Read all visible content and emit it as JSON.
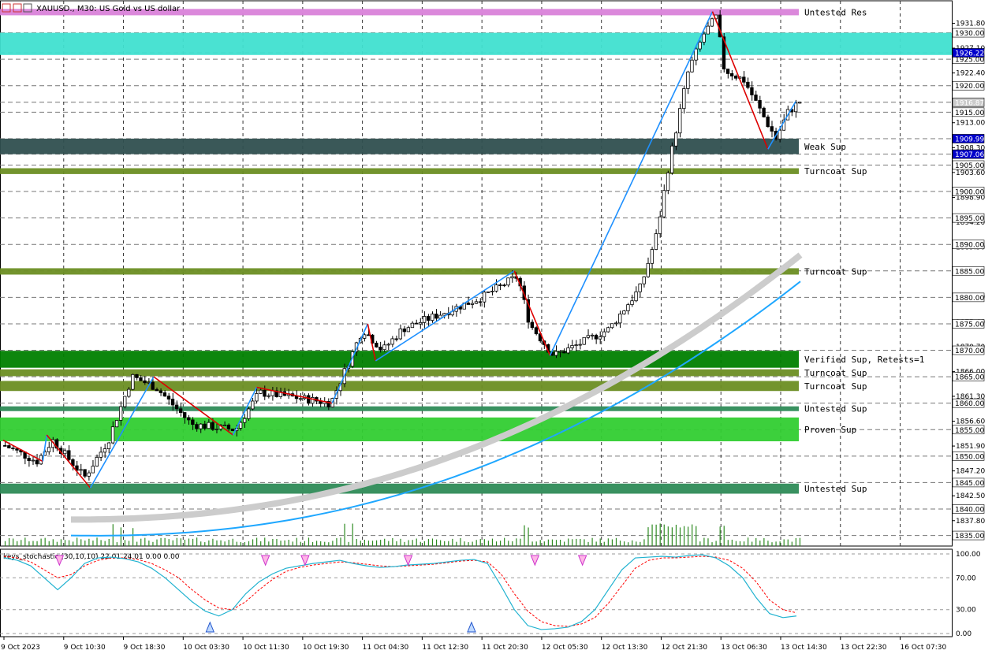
{
  "chart_data": {
    "type": "candlestick",
    "title": "XAUUSD., M30: US Gold vs US dollar",
    "ylim": [
      1833.0,
      1935.0
    ],
    "price_ticks": [
      "1931.80",
      "1927.10",
      "1922.40",
      "1913.00",
      "1908.30",
      "1903.60",
      "1898.90",
      "1894.20",
      "1889.50",
      "1880.10",
      "1875.40",
      "1870.70",
      "1866.00",
      "1861.30",
      "1856.60",
      "1851.90",
      "1847.20",
      "1842.50",
      "1837.80"
    ],
    "price_boxes": [
      {
        "value": 1930.0,
        "label": "1930.00",
        "bg": "#ffffff",
        "fg": "#000000"
      },
      {
        "value": 1925.0,
        "label": "1925.00",
        "bg": "#ffffff",
        "fg": "#000000"
      },
      {
        "value": 1926.22,
        "label": "1926.22",
        "bg": "#0000cc",
        "fg": "#ffffff"
      },
      {
        "value": 1920.0,
        "label": "1920.00",
        "bg": "#ffffff",
        "fg": "#000000"
      },
      {
        "value": 1916.87,
        "label": "1916.87",
        "bg": "#cccccc",
        "fg": "#ffffff"
      },
      {
        "value": 1915.0,
        "label": "1915.00",
        "bg": "#ffffff",
        "fg": "#000000"
      },
      {
        "value": 1909.99,
        "label": "1909.99",
        "bg": "#0000cc",
        "fg": "#ffffff"
      },
      {
        "value": 1907.06,
        "label": "1907.06",
        "bg": "#0000cc",
        "fg": "#ffffff"
      },
      {
        "value": 1905.0,
        "label": "1905.00",
        "bg": "#ffffff",
        "fg": "#000000"
      },
      {
        "value": 1900.0,
        "label": "1900.00",
        "bg": "#ffffff",
        "fg": "#000000"
      },
      {
        "value": 1895.0,
        "label": "1895.00",
        "bg": "#ffffff",
        "fg": "#000000"
      },
      {
        "value": 1890.0,
        "label": "1890.00",
        "bg": "#ffffff",
        "fg": "#000000"
      },
      {
        "value": 1885.0,
        "label": "1885.00",
        "bg": "#ffffff",
        "fg": "#000000"
      },
      {
        "value": 1880.0,
        "label": "1880.00",
        "bg": "#ffffff",
        "fg": "#000000"
      },
      {
        "value": 1875.0,
        "label": "1875.00",
        "bg": "#ffffff",
        "fg": "#000000"
      },
      {
        "value": 1870.0,
        "label": "1870.00",
        "bg": "#ffffff",
        "fg": "#000000"
      },
      {
        "value": 1865.0,
        "label": "1865.00",
        "bg": "#ffffff",
        "fg": "#000000"
      },
      {
        "value": 1860.0,
        "label": "1860.00",
        "bg": "#ffffff",
        "fg": "#000000"
      },
      {
        "value": 1855.0,
        "label": "1855.00",
        "bg": "#ffffff",
        "fg": "#000000"
      },
      {
        "value": 1850.0,
        "label": "1850.00",
        "bg": "#ffffff",
        "fg": "#000000"
      },
      {
        "value": 1845.0,
        "label": "1845.00",
        "bg": "#ffffff",
        "fg": "#000000"
      },
      {
        "value": 1840.0,
        "label": "1840.00",
        "bg": "#ffffff",
        "fg": "#000000"
      },
      {
        "value": 1835.0,
        "label": "1835.00",
        "bg": "#ffffff",
        "fg": "#000000"
      }
    ],
    "x_labels": [
      "9 Oct 2023",
      "9 Oct 10:30",
      "9 Oct 18:30",
      "10 Oct 03:30",
      "10 Oct 11:30",
      "10 Oct 19:30",
      "11 Oct 04:30",
      "11 Oct 12:30",
      "11 Oct 20:30",
      "12 Oct 05:30",
      "12 Oct 13:30",
      "12 Oct 21:30",
      "13 Oct 06:30",
      "13 Oct 14:30",
      "13 Oct 22:30",
      "16 Oct 07:30"
    ],
    "zones": [
      {
        "label": "Untested Res",
        "top": 1934.5,
        "bottom": 1933.3,
        "color": "#d982d9",
        "x_end": 0.66
      },
      {
        "label": "",
        "top": 1930.0,
        "bottom": 1925.8,
        "color": "#40e0d0",
        "x_end": 1.0
      },
      {
        "label": "Weak Sup",
        "top": 1909.99,
        "bottom": 1907.06,
        "color": "#2f4f4f",
        "x_end": 0.66
      },
      {
        "label": "Turncoat Sup",
        "top": 1904.4,
        "bottom": 1903.3,
        "color": "#6b8e23",
        "x_end": 0.66
      },
      {
        "label": "Turncoat Sup",
        "top": 1885.5,
        "bottom": 1884.3,
        "color": "#6b8e23",
        "x_end": 0.66
      },
      {
        "label": "Verified Sup, Retests=1",
        "top": 1869.9,
        "bottom": 1866.7,
        "color": "#008000",
        "x_end": 0.66
      },
      {
        "label": "Turncoat Sup",
        "top": 1866.4,
        "bottom": 1865.1,
        "color": "#6b8e23",
        "x_end": 0.66
      },
      {
        "label": "Turncoat Sup",
        "top": 1864.2,
        "bottom": 1862.3,
        "color": "#6b8e23",
        "x_end": 0.66
      },
      {
        "label": "Untested Sup",
        "top": 1859.4,
        "bottom": 1858.5,
        "color": "#2e8b57",
        "x_end": 0.66
      },
      {
        "label": "Proven Sup",
        "top": 1857.3,
        "bottom": 1852.8,
        "color": "#32cd32",
        "x_end": 0.66
      },
      {
        "label": "Untested Sup",
        "top": 1844.8,
        "bottom": 1842.9,
        "color": "#2e8b57",
        "x_end": 0.66
      }
    ],
    "indicator": {
      "label": "keys_stochastic (30,10,10) 22.01 24.01 0.00 0.00",
      "ticks": [
        "100.00",
        "70.00",
        "30.00",
        "0.00"
      ],
      "main": [
        95,
        92,
        85,
        70,
        55,
        70,
        88,
        95,
        96,
        94,
        90,
        82,
        70,
        55,
        40,
        28,
        22,
        30,
        50,
        65,
        75,
        82,
        85,
        88,
        90,
        92,
        88,
        85,
        83,
        84,
        86,
        87,
        88,
        90,
        92,
        93,
        88,
        60,
        30,
        10,
        5,
        6,
        8,
        15,
        30,
        55,
        80,
        95,
        96,
        97,
        96,
        98,
        99,
        95,
        85,
        70,
        45,
        25,
        20,
        22
      ],
      "signal": [
        97,
        95,
        90,
        80,
        70,
        74,
        85,
        92,
        95,
        95,
        93,
        88,
        80,
        70,
        55,
        42,
        32,
        30,
        40,
        55,
        68,
        78,
        83,
        86,
        88,
        90,
        89,
        87,
        85,
        84,
        85,
        86,
        87,
        89,
        91,
        92,
        90,
        75,
        50,
        28,
        15,
        10,
        9,
        12,
        20,
        38,
        60,
        82,
        92,
        95,
        95,
        96,
        97,
        96,
        92,
        82,
        65,
        42,
        30,
        26
      ],
      "arrows_down": [
        0.07,
        0.33,
        0.38,
        0.51,
        0.67,
        0.73
      ],
      "arrows_up": [
        0.26,
        0.59
      ]
    }
  }
}
